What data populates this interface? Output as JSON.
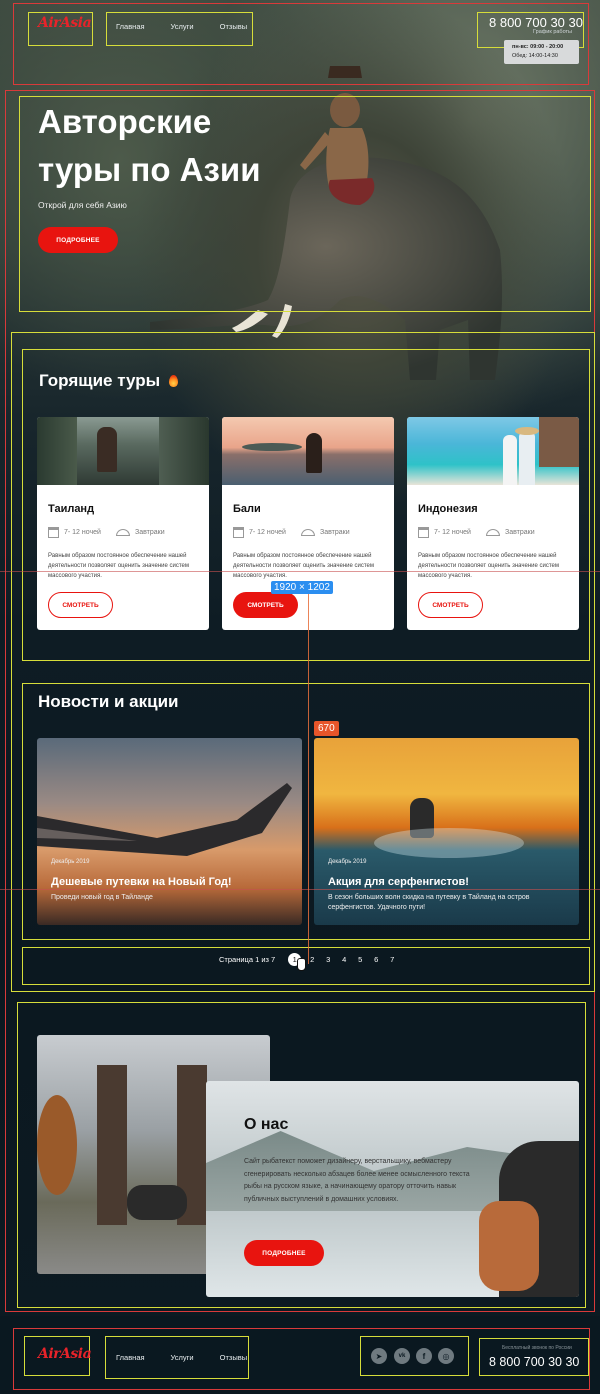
{
  "header": {
    "logo": "AirAsia",
    "nav": [
      "Главная",
      "Услуги",
      "Отзывы"
    ],
    "phone": "8 800 700 30 30",
    "schedule_label": "График работы",
    "hours_line1": "пн-вс: 09:00 - 20:00",
    "hours_line2": "Обед: 14:00-14:30"
  },
  "hero": {
    "title_line1": "Авторские",
    "title_line2": "туры по Азии",
    "subtitle": "Открой для себя Азию",
    "button": "ПОДРОБНЕЕ"
  },
  "hot_tours": {
    "title": "Горящие туры",
    "cards": [
      {
        "name": "Таиланд",
        "nights": "7- 12 ночей",
        "meal": "Завтраки",
        "desc": "Равным образом постоянное обеспечение нашей деятельности позволяет оценить значение систем массового участия.",
        "button": "СМОТРЕТЬ"
      },
      {
        "name": "Бали",
        "nights": "7- 12 ночей",
        "meal": "Завтраки",
        "desc": "Равным образом постоянное обеспечение нашей деятельности позволяет оценить значение систем массового участия.",
        "button": "СМОТРЕТЬ"
      },
      {
        "name": "Индонезия",
        "nights": "7- 12 ночей",
        "meal": "Завтраки",
        "desc": "Равным образом постоянное обеспечение нашей деятельности позволяет оценить значение систем массового участия.",
        "button": "СМОТРЕТЬ"
      }
    ]
  },
  "news": {
    "title": "Новости и акции",
    "items": [
      {
        "date": "Декабрь 2019",
        "title": "Дешевые путевки на Новый Год!",
        "text": "Проведи новый год в Тайланде"
      },
      {
        "date": "Декабрь 2019",
        "title": "Акция для серфенгистов!",
        "text": "В сезон больших волн скидка на путевку в Тайланд на остров серфенгистов. Удачного пути!"
      }
    ]
  },
  "pagination": {
    "label": "Страница 1 из 7",
    "pages": [
      "1",
      "2",
      "3",
      "4",
      "5",
      "6",
      "7"
    ],
    "current": "1"
  },
  "about": {
    "title": "О нас",
    "text": "Сайт рыбатекст поможет дизайнеру, верстальщику, вебмастеру сгенерировать несколько абзацев более менее осмысленного текста рыбы на русском языке, а начинающему оратору отточить навык публичных выступлений в домашних условиях.",
    "button": "ПОДРОБНЕЕ"
  },
  "footer": {
    "logo": "AirAsia",
    "nav": [
      "Главная",
      "Услуги",
      "Отзывы"
    ],
    "free_call": "Бесплатный звонок по России",
    "phone": "8 800 700 30 30",
    "social": [
      "telegram-icon",
      "vk-icon",
      "facebook-icon",
      "instagram-icon"
    ]
  },
  "overlay": {
    "dimension": "1920 × 1202",
    "offset": "670"
  }
}
